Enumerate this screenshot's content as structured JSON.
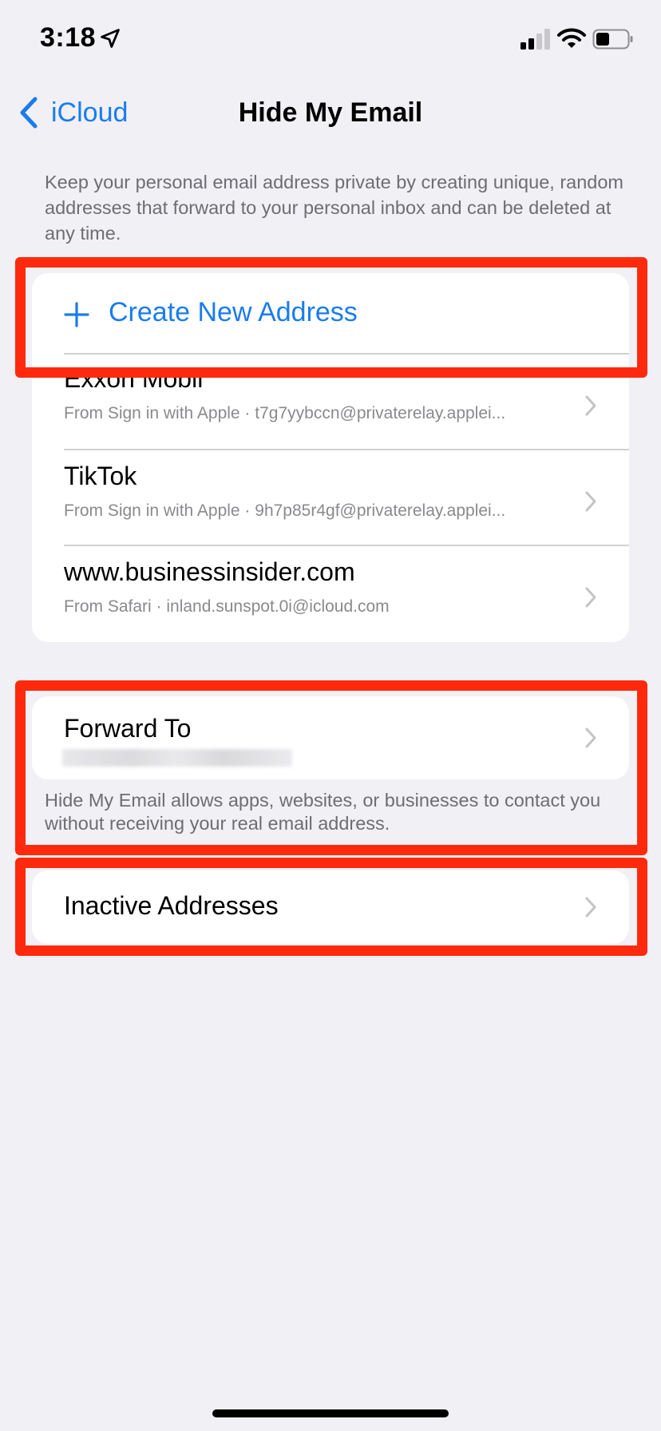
{
  "status_bar": {
    "time": "3:18",
    "icons": [
      "location-arrow-icon",
      "cellular-signal-icon",
      "wifi-icon",
      "battery-icon"
    ]
  },
  "nav": {
    "back_label": "iCloud",
    "title": "Hide My Email"
  },
  "intro_text": "Keep your personal email address private by creating unique, random addresses that forward to your personal inbox and can be deleted at any time.",
  "create": {
    "label": "Create New Address",
    "icon": "plus-icon"
  },
  "addresses": [
    {
      "title": "Exxon Mobil",
      "subtitle": "From Sign in with Apple · t7g7yybccn@privaterelay.applei..."
    },
    {
      "title": "TikTok",
      "subtitle": "From Sign in with Apple · 9h7p85r4gf@privaterelay.applei..."
    },
    {
      "title": "www.businessinsider.com",
      "subtitle": "From Safari · inland.sunspot.0i@icloud.com"
    }
  ],
  "forward": {
    "title": "Forward To",
    "note": "Hide My Email allows apps, websites, or businesses to contact you without receiving your real email address."
  },
  "inactive": {
    "title": "Inactive Addresses"
  },
  "colors": {
    "accent": "#1A7CEC",
    "background": "#F0F0F5",
    "highlight": "#FF2A0D",
    "secondary_text": "#6D6D72"
  }
}
